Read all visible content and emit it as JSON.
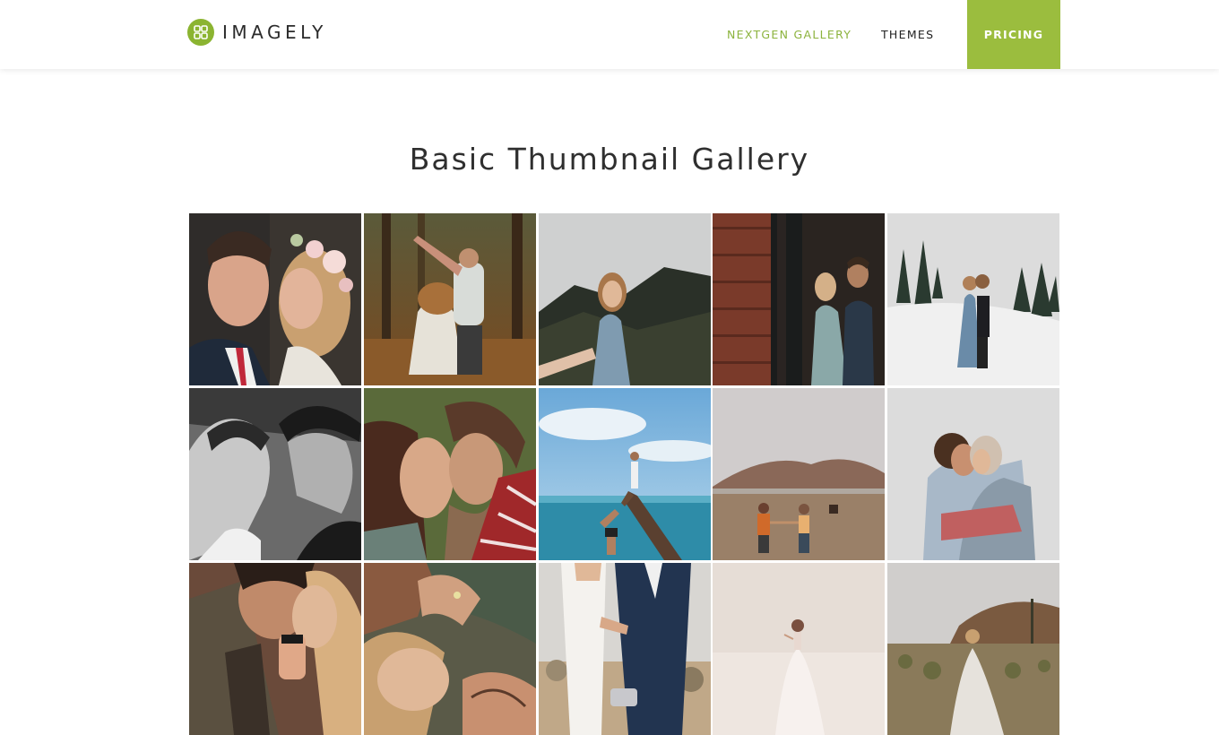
{
  "brand": {
    "name": "IMAGELY",
    "icon": "four-squares-logo-icon",
    "color": "#8bb431"
  },
  "nav": {
    "gallery_label": "NEXTGEN GALLERY",
    "themes_label": "THEMES",
    "pricing_label": "PRICING",
    "active_color": "#8cb33d",
    "pricing_bg": "#9bbd3e"
  },
  "page": {
    "title": "Basic Thumbnail Gallery"
  },
  "gallery": {
    "columns": 5,
    "thumbnails": [
      {
        "row": 1,
        "col": 1,
        "subject": "couple-portrait-flower-crown"
      },
      {
        "row": 1,
        "col": 2,
        "subject": "couple-dancing-forest"
      },
      {
        "row": 1,
        "col": 3,
        "subject": "woman-blue-dress-mountains"
      },
      {
        "row": 1,
        "col": 4,
        "subject": "couple-by-brick-doorway"
      },
      {
        "row": 1,
        "col": 5,
        "subject": "couple-snowy-hill"
      },
      {
        "row": 2,
        "col": 1,
        "subject": "couple-black-and-white"
      },
      {
        "row": 2,
        "col": 2,
        "subject": "couple-nose-to-nose"
      },
      {
        "row": 2,
        "col": 3,
        "subject": "couple-on-tree-by-ocean"
      },
      {
        "row": 2,
        "col": 4,
        "subject": "couple-holding-hands-field"
      },
      {
        "row": 2,
        "col": 5,
        "subject": "couple-embrace-blanket"
      },
      {
        "row": 3,
        "col": 1,
        "subject": "couple-close-warm"
      },
      {
        "row": 3,
        "col": 2,
        "subject": "couple-hands-ring"
      },
      {
        "row": 3,
        "col": 3,
        "subject": "couple-desert-suit"
      },
      {
        "row": 3,
        "col": 4,
        "subject": "bride-salt-flats"
      },
      {
        "row": 3,
        "col": 5,
        "subject": "bride-desert-joshua-trees"
      }
    ]
  }
}
